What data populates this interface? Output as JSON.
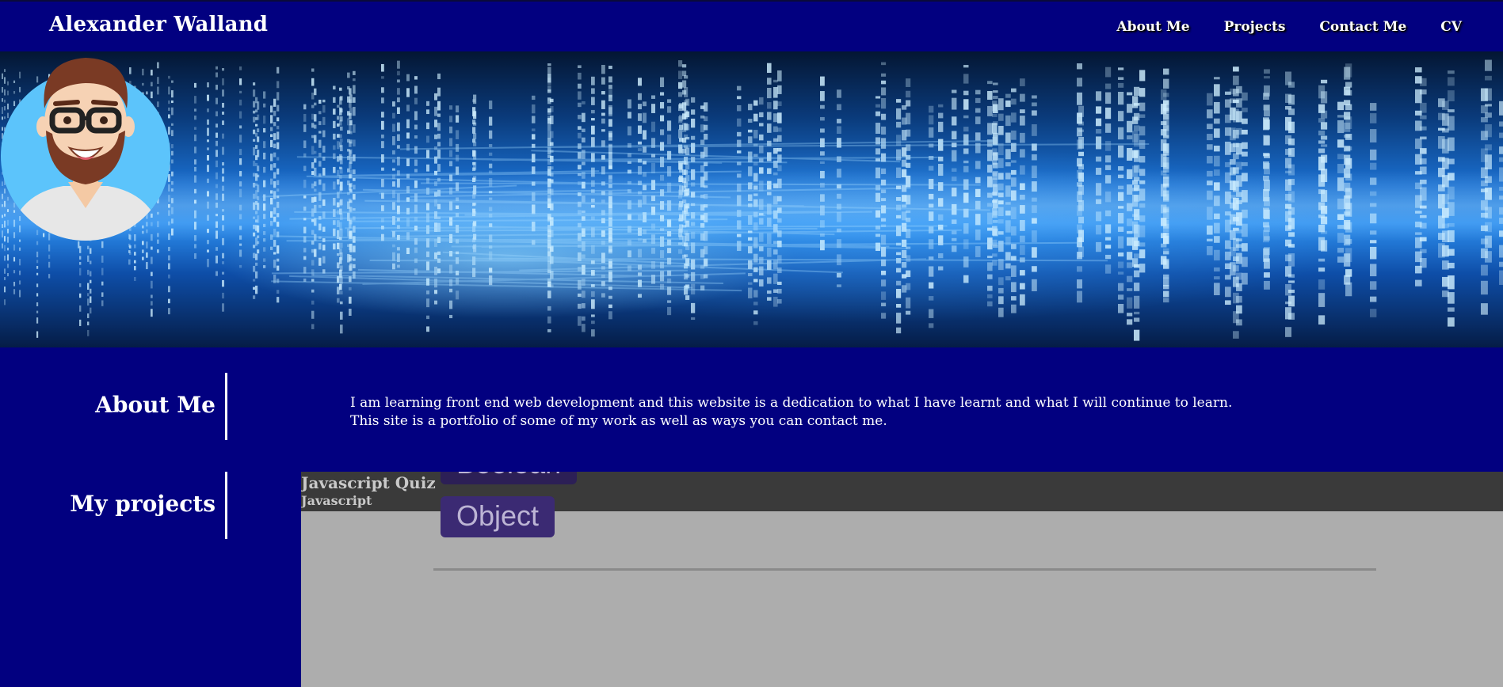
{
  "header": {
    "site_title": "Alexander Walland",
    "nav": [
      {
        "label": "About Me"
      },
      {
        "label": "Projects"
      },
      {
        "label": "Contact Me"
      },
      {
        "label": "CV"
      }
    ]
  },
  "hero": {
    "avatar_icon": "bearded-man-avatar-icon"
  },
  "about": {
    "title": "About Me",
    "line1": "I am learning front end web development and this website is a dedication to what I have learnt and what I will continue to learn.",
    "line2": "This site is a portfolio of some of my work as well as ways you can contact me."
  },
  "projects": {
    "title": "My projects",
    "items": [
      {
        "title": "Javascript Quiz",
        "tag": "Javascript",
        "preview_buttons": [
          "Boolean",
          "Object"
        ]
      }
    ]
  },
  "colors": {
    "navy": "#020080",
    "project_bar": "#3a3a3a",
    "project_panel": "#adadad",
    "quiz_button": "#3b2a73"
  }
}
